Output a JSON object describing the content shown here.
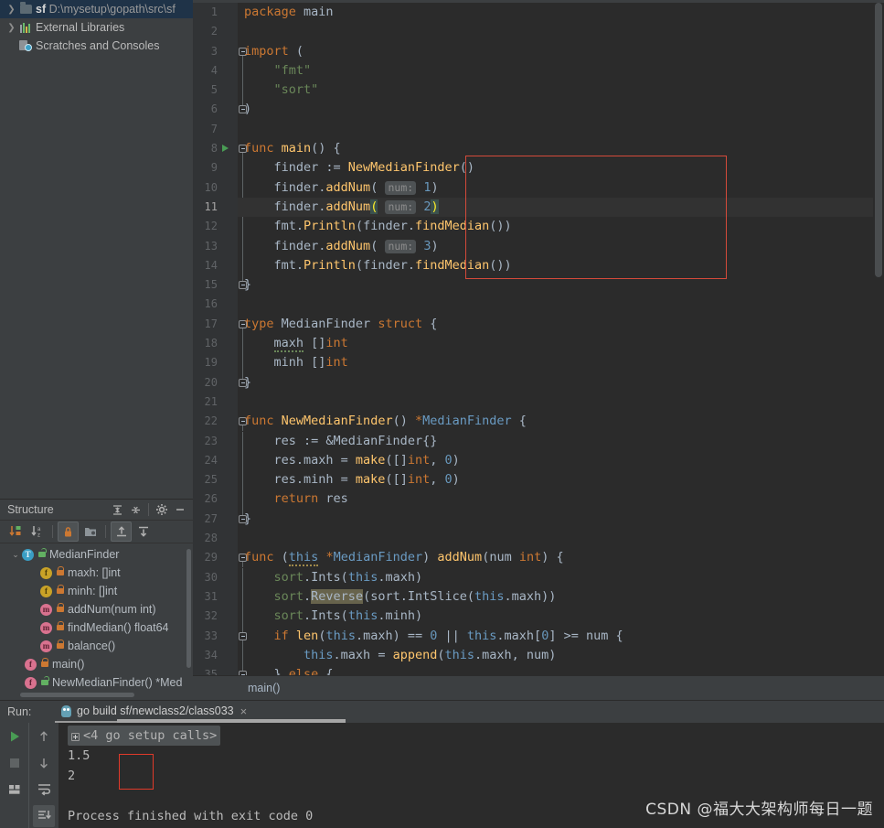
{
  "window": {
    "theme_bg": "#3c3f41",
    "editor_bg": "#2b2b2b",
    "accent": "#4e9fd1"
  },
  "project_tree": {
    "items": [
      {
        "chevron": "❯",
        "icon": "folder-icon",
        "name": "sf",
        "path": "D:\\mysetup\\gopath\\src\\sf",
        "selected": true
      },
      {
        "chevron": "❯",
        "icon": "library-icon",
        "name": "External Libraries",
        "path": "",
        "selected": false
      },
      {
        "chevron": "",
        "icon": "scratches-icon",
        "name": "Scratches and Consoles",
        "path": "",
        "selected": false
      }
    ]
  },
  "structure": {
    "title": "Structure",
    "header_buttons": [
      "expand-all-icon",
      "collapse-all-icon",
      "gear-icon",
      "minimize-icon"
    ],
    "toolbar_buttons": [
      "sort-by-visibility-icon",
      "sort-alphabetically-icon",
      "show-non-public-icon",
      "group-icon",
      "scroll-from-source-icon",
      "scroll-to-source-icon"
    ],
    "items": [
      {
        "indent": 0,
        "chevron": "∨",
        "badge": "T",
        "badge_kind": "type",
        "lock": "open",
        "label": "MedianFinder"
      },
      {
        "indent": 1,
        "chevron": "",
        "badge": "f",
        "badge_kind": "field",
        "lock": "closed",
        "label": "maxh: []int"
      },
      {
        "indent": 1,
        "chevron": "",
        "badge": "f",
        "badge_kind": "field",
        "lock": "closed",
        "label": "minh: []int"
      },
      {
        "indent": 1,
        "chevron": "",
        "badge": "m",
        "badge_kind": "method",
        "lock": "closed",
        "label": "addNum(num int)"
      },
      {
        "indent": 1,
        "chevron": "",
        "badge": "m",
        "badge_kind": "method",
        "lock": "closed",
        "label": "findMedian() float64"
      },
      {
        "indent": 1,
        "chevron": "",
        "badge": "m",
        "badge_kind": "method",
        "lock": "closed",
        "label": "balance()"
      },
      {
        "indent": 0,
        "chevron": "",
        "badge": "f",
        "badge_kind": "func",
        "lock": "closed",
        "label": "main()"
      },
      {
        "indent": 0,
        "chevron": "",
        "badge": "f",
        "badge_kind": "func",
        "lock": "open",
        "label": "NewMedianFinder() *Med"
      }
    ]
  },
  "editor": {
    "current_line": 11,
    "run_marker_line": 8,
    "breadcrumb": "main()",
    "highlight_box": {
      "from_line": 9,
      "to_line": 14,
      "color": "#d44a3a"
    },
    "lines": [
      {
        "n": 1,
        "text": "package main"
      },
      {
        "n": 2,
        "text": ""
      },
      {
        "n": 3,
        "text": "import ("
      },
      {
        "n": 4,
        "text": "    \"fmt\""
      },
      {
        "n": 5,
        "text": "    \"sort\""
      },
      {
        "n": 6,
        "text": ")"
      },
      {
        "n": 7,
        "text": ""
      },
      {
        "n": 8,
        "text": "func main() {"
      },
      {
        "n": 9,
        "text": "    finder := NewMedianFinder()"
      },
      {
        "n": 10,
        "text": "    finder.addNum( num: 1)"
      },
      {
        "n": 11,
        "text": "    finder.addNum( num: 2)"
      },
      {
        "n": 12,
        "text": "    fmt.Println(finder.findMedian())"
      },
      {
        "n": 13,
        "text": "    finder.addNum( num: 3)"
      },
      {
        "n": 14,
        "text": "    fmt.Println(finder.findMedian())"
      },
      {
        "n": 15,
        "text": "}"
      },
      {
        "n": 16,
        "text": ""
      },
      {
        "n": 17,
        "text": "type MedianFinder struct {"
      },
      {
        "n": 18,
        "text": "    maxh []int"
      },
      {
        "n": 19,
        "text": "    minh []int"
      },
      {
        "n": 20,
        "text": "}"
      },
      {
        "n": 21,
        "text": ""
      },
      {
        "n": 22,
        "text": "func NewMedianFinder() *MedianFinder {"
      },
      {
        "n": 23,
        "text": "    res := &MedianFinder{}"
      },
      {
        "n": 24,
        "text": "    res.maxh = make([]int, 0)"
      },
      {
        "n": 25,
        "text": "    res.minh = make([]int, 0)"
      },
      {
        "n": 26,
        "text": "    return res"
      },
      {
        "n": 27,
        "text": "}"
      },
      {
        "n": 28,
        "text": ""
      },
      {
        "n": 29,
        "text": "func (this *MedianFinder) addNum(num int) {"
      },
      {
        "n": 30,
        "text": "    sort.Ints(this.maxh)"
      },
      {
        "n": 31,
        "text": "    sort.Reverse(sort.IntSlice(this.maxh))"
      },
      {
        "n": 32,
        "text": "    sort.Ints(this.minh)"
      },
      {
        "n": 33,
        "text": "    if len(this.maxh) == 0 || this.maxh[0] >= num {"
      },
      {
        "n": 34,
        "text": "        this.maxh = append(this.maxh, num)"
      },
      {
        "n": 35,
        "text": "    } else {"
      }
    ],
    "param_hints": [
      "num:",
      "num:",
      "num:"
    ],
    "token_colors": {
      "keyword": "#cc7832",
      "string": "#6a8759",
      "number": "#6897bb",
      "function": "#ffc66d",
      "default": "#a9b7c6",
      "field": "#9876aa",
      "hint_bg": "#4e5254"
    }
  },
  "run_panel": {
    "label": "Run:",
    "tab": {
      "icon": "go-gopher-icon",
      "title": "go build sf/newclass2/class033",
      "close": "×"
    },
    "left_buttons": [
      "rerun-icon",
      "stop-icon",
      "layout-icon"
    ],
    "nav_buttons": [
      "up-arrow-icon",
      "down-arrow-icon",
      "soft-wrap-icon",
      "scroll-to-end-icon"
    ],
    "console": {
      "fold_label": "<4 go setup calls>",
      "output_lines": [
        "1.5",
        "2"
      ],
      "status": "Process finished with exit code 0",
      "highlight_box_color": "#e03a2a"
    }
  },
  "watermark": {
    "text": "CSDN @福大大架构师每日一题"
  }
}
